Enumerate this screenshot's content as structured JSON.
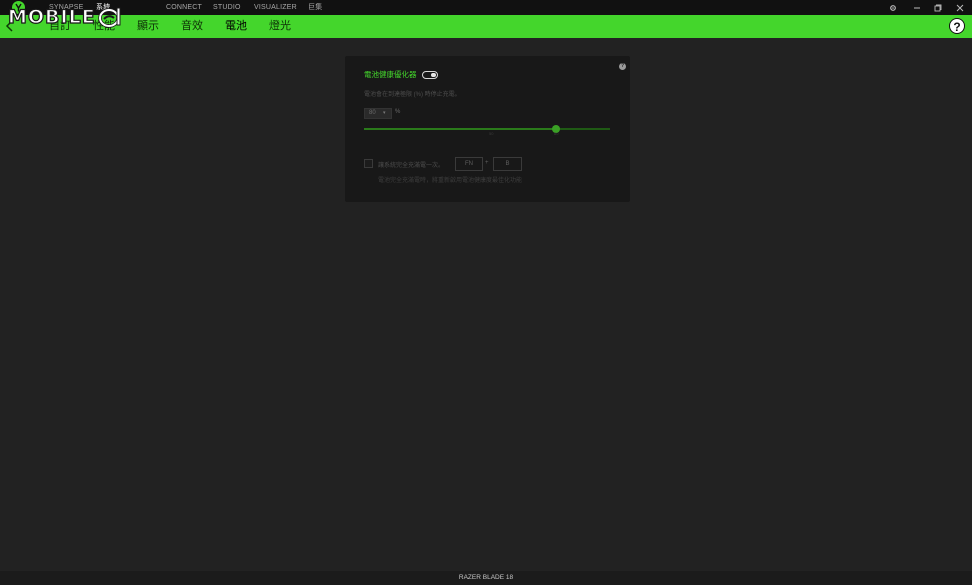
{
  "topnav": {
    "items": [
      {
        "label": "SYNAPSE",
        "active": false
      },
      {
        "label": "系統",
        "active": true
      },
      {
        "label": "",
        "active": false
      },
      {
        "label": "CONNECT",
        "active": false
      },
      {
        "label": "STUDIO",
        "active": false
      },
      {
        "label": "VISUALIZER",
        "active": false
      },
      {
        "label": "巨集",
        "active": false
      }
    ],
    "watermark": "MOBILE",
    "settings_icon": "gear-icon",
    "restore_icon": "restore-icon",
    "close_icon": "close-icon"
  },
  "subnav": {
    "back_icon": "chevron-left-icon",
    "tabs": [
      {
        "label": "自訂",
        "active": false
      },
      {
        "label": "性能",
        "active": false
      },
      {
        "label": "顯示",
        "active": false
      },
      {
        "label": "音效",
        "active": false
      },
      {
        "label": "電池",
        "active": true
      },
      {
        "label": "燈光",
        "active": false
      }
    ],
    "help_label": "?"
  },
  "panel": {
    "help_label": "?",
    "title": "電池健康優化器",
    "toggle_on": true,
    "description": "電池會在到達極限 (%) 時停止充電。",
    "limit_value": "80",
    "unit": "%",
    "slider_fraction": 0.78,
    "tick_low": "50",
    "tick_high": "80",
    "full_charge_label": "讓系統完全充滿電一次。",
    "key1": "FN",
    "key_plus": "+",
    "key2": "B",
    "full_charge_desc": "電池完全充滿電時，將重新啟用電池健康度最佳化功能",
    "accent": "#44d62c"
  },
  "status": {
    "device_name": "RAZER BLADE 18"
  }
}
